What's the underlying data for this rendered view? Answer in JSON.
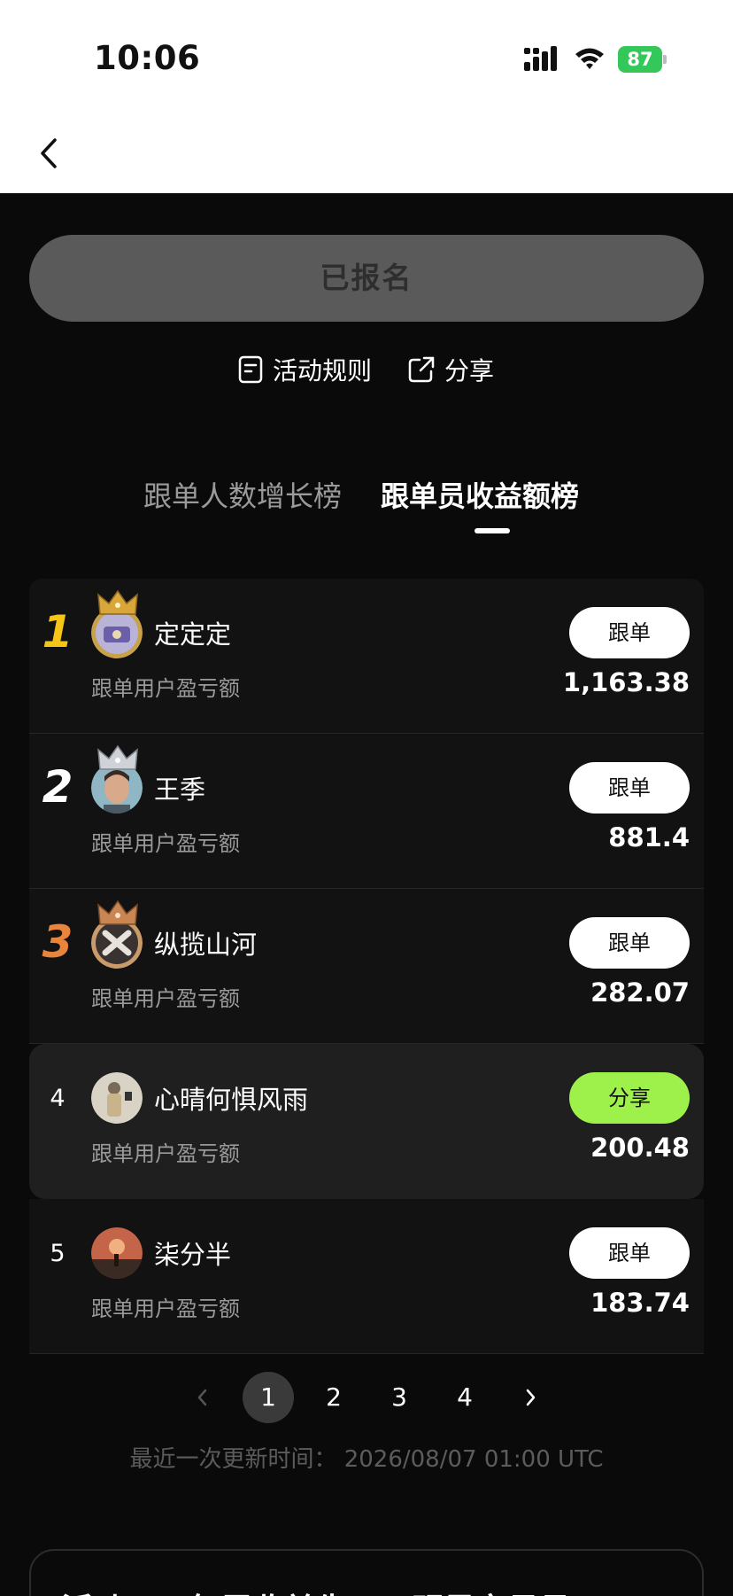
{
  "status_bar": {
    "time": "10:06",
    "battery_percent": "87"
  },
  "registration": {
    "label": "已报名"
  },
  "links": {
    "rules": "活动规则",
    "share": "分享"
  },
  "tabs": [
    {
      "label": "跟单人数增长榜",
      "active": false
    },
    {
      "label": "跟单员收益额榜",
      "active": true
    }
  ],
  "leaderboard": [
    {
      "rank": "1",
      "name": "定定定",
      "sublabel": "跟单用户盈亏额",
      "action": "跟单",
      "amount": "1,163.38",
      "rank_color": "#f5c518"
    },
    {
      "rank": "2",
      "name": "王季",
      "sublabel": "跟单用户盈亏额",
      "action": "跟单",
      "amount": "881.4",
      "rank_color": "#ffffff"
    },
    {
      "rank": "3",
      "name": "纵揽山河",
      "sublabel": "跟单用户盈亏额",
      "action": "跟单",
      "amount": "282.07",
      "rank_color": "#e8843c"
    },
    {
      "rank": "4",
      "name": "心晴何惧风雨",
      "sublabel": "跟单用户盈亏额",
      "action": "分享",
      "amount": "200.48",
      "is_me": true
    },
    {
      "rank": "5",
      "name": "柒分半",
      "sublabel": "跟单用户盈亏额",
      "action": "跟单",
      "amount": "183.74"
    }
  ],
  "pagination": {
    "pages": [
      "1",
      "2",
      "3",
      "4"
    ],
    "current": "1"
  },
  "last_updated": "最近一次更新时间：  2026/08/07 01:00 UTC",
  "promo": {
    "text": "活动一：每周收益先天，明星交易员"
  },
  "colors": {
    "accent_green": "#9ef04a",
    "gold": "#f5c518",
    "bronze": "#e8843c"
  }
}
